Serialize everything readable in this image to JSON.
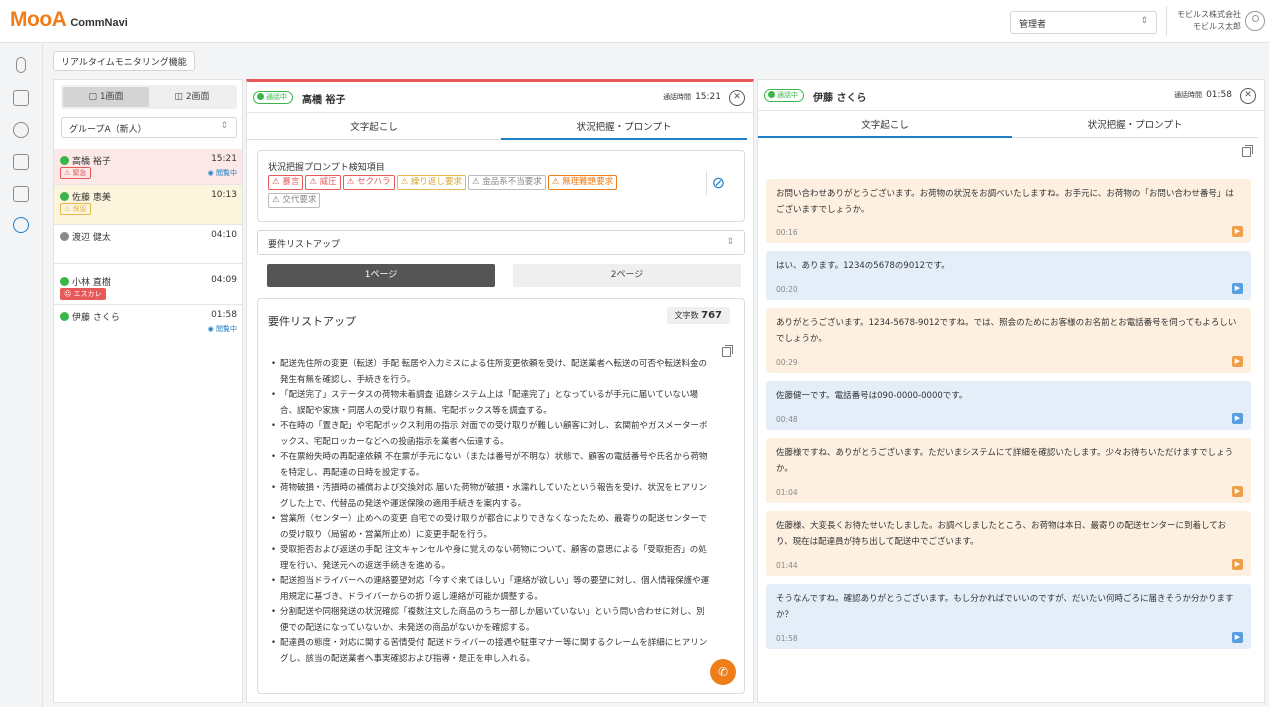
{
  "brand": {
    "logo": "MooA",
    "product": "CommNavi",
    "accent": "#ef7d1a"
  },
  "header": {
    "role_select": "管理者",
    "company": "モビルス株式会社",
    "user": "モビルス太郎"
  },
  "nav": {
    "icons": [
      "microphone-icon",
      "clipboard-icon",
      "gear-icon",
      "document-search-icon",
      "monitor-icon",
      "realtime-icon"
    ]
  },
  "page": {
    "subheader": "リアルタイムモニタリング機能"
  },
  "list": {
    "view_1": "1画面",
    "view_2": "2画面",
    "group": "グループA（新人）",
    "items": [
      {
        "name": "高橋 裕子",
        "time": "15:21",
        "tag": "緊急",
        "watch": "閲覧中",
        "status": "green"
      },
      {
        "name": "佐藤 恵美",
        "time": "10:13",
        "tag": "保留",
        "status": "green"
      },
      {
        "name": "渡辺 健太",
        "time": "04:10",
        "status": "grey"
      },
      {
        "name": "小林 直樹",
        "time": "04:09",
        "tag": "エスカレ",
        "status": "green"
      },
      {
        "name": "伊藤 さくら",
        "time": "01:58",
        "watch": "閲覧中",
        "status": "green"
      }
    ]
  },
  "left_call": {
    "status": "通話中",
    "agent": "高橋 裕子",
    "time_label": "通話時間",
    "time": "15:21",
    "tabs": [
      "文字起こし",
      "状況把握・プロンプト"
    ],
    "detect_title": "状況把握プロンプト検知項目",
    "keywords": [
      "暴言",
      "威圧",
      "セクハラ",
      "繰り返し要求",
      "金品系不当要求",
      "無理難題要求",
      "交代要求"
    ],
    "req_select": "要件リストアップ",
    "page1": "1ページ",
    "page2": "2ページ",
    "req_title": "要件リストアップ",
    "char_label": "文字数",
    "char_count": "767",
    "requirements": [
      "配送先住所の変更（転送）手配 転居や入力ミスによる住所変更依頼を受け、配送業者へ転送の可否や転送料金の発生有無を確認し、手続きを行う。",
      "「配送完了」ステータスの荷物未着調査 追跡システム上は「配達完了」となっているが手元に届いていない場合、誤配や家族・同居人の受け取り有無、宅配ボックス等を調査する。",
      "不在時の「置き配」や宅配ボックス利用の指示 対面での受け取りが難しい顧客に対し、玄関前やガスメーターボックス、宅配ロッカーなどへの投函指示を業者へ伝達する。",
      "不在票紛失時の再配達依頼 不在票が手元にない（または番号が不明な）状態で、顧客の電話番号や氏名から荷物を特定し、再配達の日時を設定する。",
      "荷物破損・汚損時の補償および交換対応 届いた荷物が破損・水濡れしていたという報告を受け、状況をヒアリングした上で、代替品の発送や運送保険の適用手続きを案内する。",
      "営業所（センター）止めへの変更 自宅での受け取りが都合によりできなくなったため、最寄りの配送センターでの受け取り（局留め・営業所止め）に変更手配を行う。",
      "受取拒否および返送の手配 注文キャンセルや身に覚えのない荷物について、顧客の意思による「受取拒否」の処理を行い、発送元への返送手続きを進める。",
      "配送担当ドライバーへの連絡要望対応「今すぐ来てほしい」「連絡が欲しい」等の要望に対し、個人情報保護や運用規定に基づき、ドライバーからの折り返し連絡が可能か調整する。",
      "分割配送や同梱発送の状況確認「複数注文した商品のうち一部しか届いていない」という問い合わせに対し、別便での配送になっていないか、未発送の商品がないかを確認する。",
      "配達員の態度・対応に関する苦情受付 配送ドライバーの接遇や駐車マナー等に関するクレームを詳細にヒアリングし、該当の配送業者へ事実確認および指導・是正を申し入れる。"
    ]
  },
  "right_call": {
    "status": "通話中",
    "agent": "伊藤 さくら",
    "time_label": "通話時間",
    "time": "01:58",
    "tabs": [
      "文字起こし",
      "状況把握・プロンプト"
    ],
    "messages": [
      {
        "role": "agent",
        "text": "お問い合わせありがとうございます。お荷物の状況をお調べいたしますね。お手元に、お荷物の「お問い合わせ番号」はございますでしょうか。",
        "time": "00:16"
      },
      {
        "role": "cust",
        "text": "はい、あります。1234の5678の9012です。",
        "time": "00:20"
      },
      {
        "role": "agent",
        "text": "ありがとうございます。1234-5678-9012ですね。では、照会のためにお客様のお名前とお電話番号を伺ってもよろしいでしょうか。",
        "time": "00:29"
      },
      {
        "role": "cust",
        "text": "佐藤健一です。電話番号は090-0000-0000です。",
        "time": "00:48"
      },
      {
        "role": "agent",
        "text": "佐藤様ですね、ありがとうございます。ただいまシステムにて詳細を確認いたします。少々お待ちいただけますでしょうか。",
        "time": "01:04"
      },
      {
        "role": "agent",
        "text": "佐藤様、大変長くお待たせいたしました。お調べしましたところ、お荷物は本日、最寄りの配送センターに到着しており、現在は配達員が持ち出して配送中でございます。",
        "time": "01:44"
      },
      {
        "role": "cust",
        "text": "そうなんですね。確認ありがとうございます。もし分かればでいいのですが、だいたい何時ごろに届きそうか分かりますか？",
        "time": "01:58"
      }
    ]
  }
}
